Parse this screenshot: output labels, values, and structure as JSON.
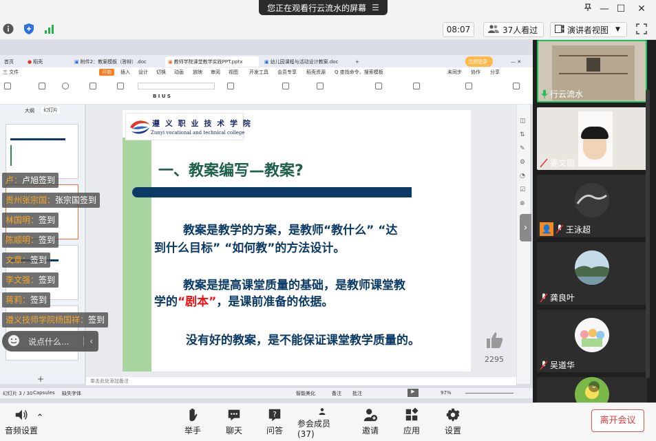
{
  "window": {
    "share_banner": "您正在观看行云流水的屏幕"
  },
  "toolbar_top": {
    "time": "08:07",
    "viewers": "37人看过",
    "view_mode": "演讲者视图"
  },
  "wps": {
    "tabs": [
      {
        "label": "首页"
      },
      {
        "label": "稻壳"
      },
      {
        "label": "附件2：教案模板（答辩）.doc"
      },
      {
        "label": "教师学院课堂教学实践PPT.pptx"
      },
      {
        "label": "幼儿园课程与活动设计教案.doc"
      }
    ],
    "menu": [
      "三 文件",
      "开始",
      "插入",
      "设计",
      "切换",
      "动画",
      "放映",
      "审阅",
      "视图",
      "开发工具",
      "会员专享",
      "稻壳资源",
      "Q 查找命令、搜索模板"
    ],
    "right_menu": [
      "未同步",
      "协作",
      "分享"
    ],
    "left_tabs": [
      "大纲",
      "幻灯片"
    ],
    "notes": "单击此处添加备注",
    "status": [
      "幻灯片 3 / 30",
      "Capsules",
      "缺失字体",
      "智能美化",
      "备注",
      "批注",
      "97%"
    ]
  },
  "slide": {
    "logo_cn": "遵 义 职 业 技 术 学 院",
    "logo_en": "Zunyi vocational and technical college",
    "title": "一、教案编写—教案?",
    "para1_line1": "教案是教学的方案，是教师“教什么” “达",
    "para1_line2": "到什么目标” “如何教”的方法设计。",
    "para2_line1": "教案是提高课堂质量的基础，是教师课堂教",
    "para2_line2_a": "学的",
    "para2_line2_red": "“剧本”",
    "para2_line2_b": "，是课前准备的依据。",
    "para3": "没有好的教案，是不能保证课堂教学质量的。"
  },
  "chat": {
    "messages": [
      {
        "who": "卢：",
        "text": "卢旭签到"
      },
      {
        "who": "贵州张宗国：",
        "text": "张宗国签到"
      },
      {
        "who": "林国明：",
        "text": "签到"
      },
      {
        "who": "陈顺明：",
        "text": "签到"
      },
      {
        "who": "文章：",
        "text": "签到"
      },
      {
        "who": "李文强：",
        "text": "签到"
      },
      {
        "who": "蒋莉：",
        "text": "签到"
      },
      {
        "who": "遵义技师学院杨国祥：",
        "text": "签到"
      }
    ],
    "input_placeholder": "说点什么..."
  },
  "likes": "2295",
  "participants": [
    {
      "name": "行云流水",
      "active": true
    },
    {
      "name": "姜文丽",
      "active": false
    },
    {
      "name": "王泳超",
      "active": false
    },
    {
      "name": "龚良叶",
      "active": false
    },
    {
      "name": "吴道华",
      "active": false
    }
  ],
  "bottom": {
    "audio": "音频设置",
    "raise_hand": "举手",
    "chat": "聊天",
    "qa": "问答",
    "members": "参会成员(37)",
    "invite": "邀请",
    "apps": "应用",
    "settings": "设置",
    "leave": "离开会议"
  }
}
